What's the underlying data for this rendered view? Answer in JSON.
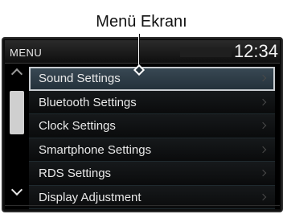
{
  "callout": {
    "label": "Menü Ekranı"
  },
  "header": {
    "title": "MENU",
    "clock": "12:34"
  },
  "menu": {
    "items": [
      {
        "label": "Sound Settings",
        "selected": true
      },
      {
        "label": "Bluetooth Settings",
        "selected": false
      },
      {
        "label": "Clock Settings",
        "selected": false
      },
      {
        "label": "Smartphone Settings",
        "selected": false
      },
      {
        "label": "RDS Settings",
        "selected": false
      },
      {
        "label": "Display Adjustment",
        "selected": false
      }
    ]
  },
  "colors": {
    "screen_bg": "#000000",
    "selected_bg": "#33424d",
    "text": "#e9e9e9"
  }
}
